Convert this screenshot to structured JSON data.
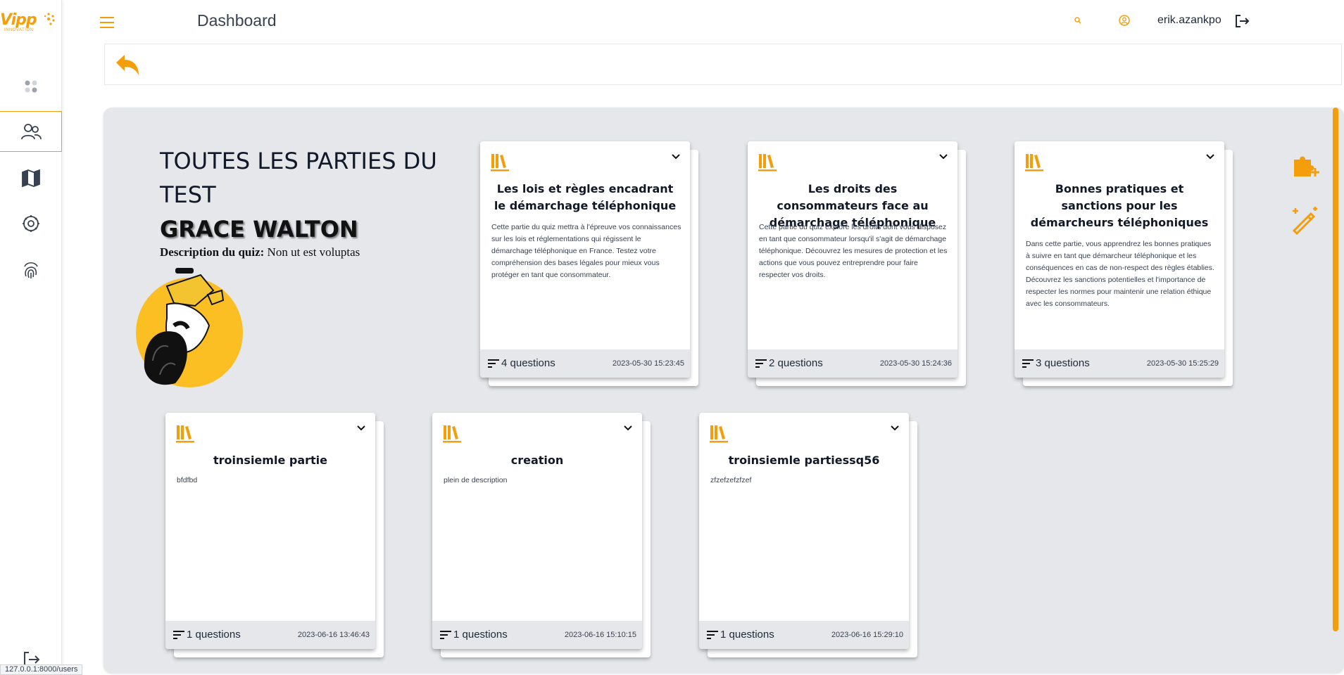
{
  "app": {
    "logo_text": "Vipp",
    "logo_sub": "INNOVATION",
    "page_title": "Dashboard",
    "username": "erik.azankpo",
    "status_url": "127.0.0.1:8000/users",
    "accent_color": "#f59e0b"
  },
  "sidebar": {
    "items": [
      {
        "icon": "dashboard-icon"
      },
      {
        "icon": "users-icon",
        "active": true
      },
      {
        "icon": "book-icon"
      },
      {
        "icon": "settings-icon"
      },
      {
        "icon": "fingerprint-icon"
      }
    ],
    "logout_icon": "logout-icon"
  },
  "intro": {
    "heading": "TOUTES LES PARTIES DU TEST",
    "name": "GRACE WALTON",
    "desc_label": "Description du quiz:",
    "desc_value": "Non ut est voluptas"
  },
  "cards": [
    {
      "title": "Les lois et règles encadrant le démarchage téléphonique",
      "description": "Cette partie du quiz mettra à l'épreuve vos connaissances sur les lois et réglementations qui régissent le démarchage téléphonique en France. Testez votre compréhension des bases légales pour mieux vous protéger en tant que consommateur.",
      "questions": "4 questions",
      "date": "2023-05-30 15:23:45"
    },
    {
      "title": "Les droits des consommateurs face au démarchage téléphonique",
      "description": "Cette partie du quiz explore les droits dont vous disposez en tant que consommateur lorsqu'il s'agit de démarchage téléphonique. Découvrez les mesures de protection et les actions que vous pouvez entreprendre pour faire respecter vos droits.",
      "questions": "2 questions",
      "date": "2023-05-30 15:24:36"
    },
    {
      "title": "Bonnes pratiques et sanctions pour les démarcheurs téléphoniques",
      "description": "Dans cette partie, vous apprendrez les bonnes pratiques à suivre en tant que démarcheur téléphonique et les conséquences en cas de non-respect des règles établies. Découvrez les sanctions potentielles et l'importance de respecter les normes pour maintenir une relation éthique avec les consommateurs.",
      "questions": "3 questions",
      "date": "2023-05-30 15:25:29"
    },
    {
      "title": "troinsiemle partie",
      "description": "bfdfbd",
      "questions": "1 questions",
      "date": "2023-06-16 13:46:43"
    },
    {
      "title": "creation",
      "description": "plein de description",
      "questions": "1 questions",
      "date": "2023-06-16 15:10:15"
    },
    {
      "title": "troinsiemle partiessq56",
      "description": "zfzefzefzfzef",
      "questions": "1 questions",
      "date": "2023-06-16 15:29:10"
    }
  ]
}
